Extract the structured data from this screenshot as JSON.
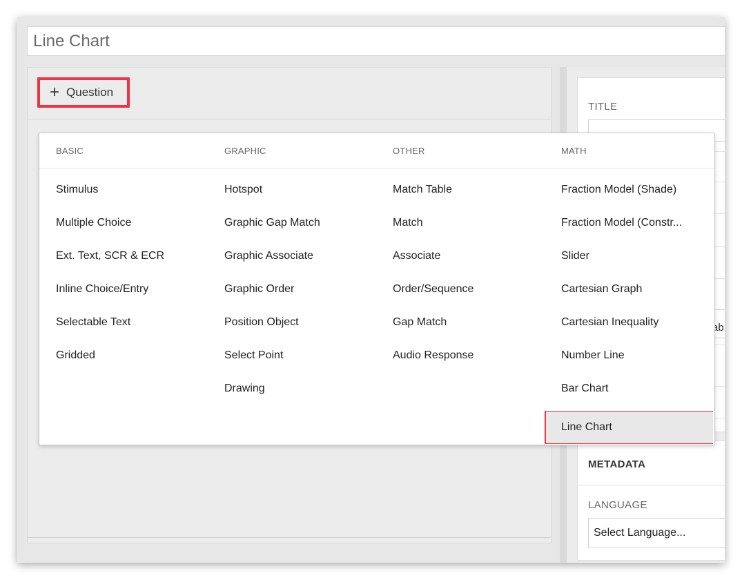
{
  "title": "Line Chart",
  "add_question_label": "Question",
  "right_panel": {
    "title_label": "TITLE",
    "side_text": "ab",
    "metadata_label": "METADATA",
    "language_label": "LANGUAGE",
    "language_value": "Select Language..."
  },
  "dropdown": {
    "columns": [
      {
        "header": "BASIC",
        "items": [
          "Stimulus",
          "Multiple Choice",
          "Ext. Text, SCR & ECR",
          "Inline Choice/Entry",
          "Selectable Text",
          "Gridded"
        ]
      },
      {
        "header": "GRAPHIC",
        "items": [
          "Hotspot",
          "Graphic Gap Match",
          "Graphic Associate",
          "Graphic Order",
          "Position Object",
          "Select Point",
          "Drawing"
        ]
      },
      {
        "header": "OTHER",
        "items": [
          "Match Table",
          "Match",
          "Associate",
          "Order/Sequence",
          "Gap Match",
          "Audio Response"
        ]
      },
      {
        "header": "MATH",
        "items": [
          "Fraction Model (Shade)",
          "Fraction Model (Constr...",
          "Slider",
          "Cartesian Graph",
          "Cartesian Inequality",
          "Number Line",
          "Bar Chart",
          "Line Chart"
        ]
      }
    ],
    "selected": "Line Chart"
  },
  "colors": {
    "highlight": "#ef3346",
    "selected_bg": "#e8e8e8"
  },
  "icons": {
    "add": "plus-icon"
  }
}
